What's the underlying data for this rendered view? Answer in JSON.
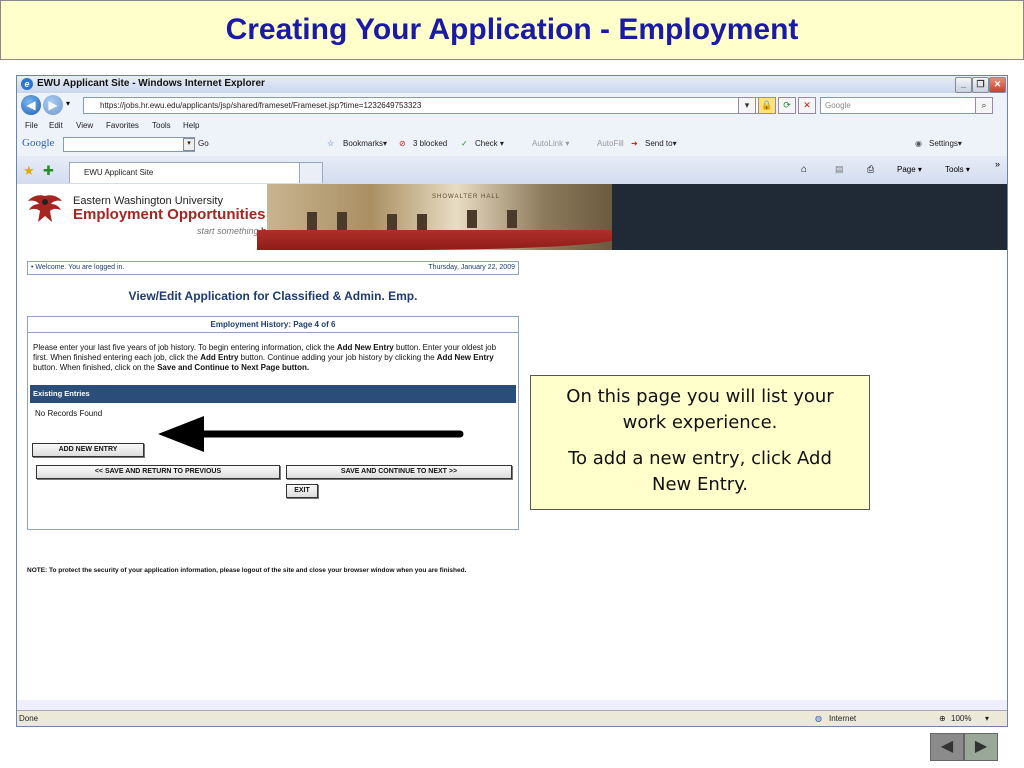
{
  "slide": {
    "title": "Creating Your Application - Employment",
    "callout_line1": "On this page you will list your work experience.",
    "callout_line2": "To add a new entry, click Add New Entry.",
    "prev_label": "◀",
    "next_label": "▶"
  },
  "browser": {
    "window_title": "EWU Applicant Site - Windows Internet Explorer",
    "url": "https://jobs.hr.ewu.edu/applicants/jsp/shared/frameset/Frameset.jsp?time=1232649753323",
    "search_placeholder": "Google",
    "menu": [
      "File",
      "Edit",
      "View",
      "Favorites",
      "Tools",
      "Help"
    ],
    "google_toolbar": {
      "logo": "Google",
      "go": "Go",
      "bookmarks": "Bookmarks▾",
      "blocked": "3 blocked",
      "check": "Check ▾",
      "autolink": "AutoLink ▾",
      "autofill": "AutoFill",
      "send_to": "Send to▾",
      "settings": "Settings▾"
    },
    "tab_label": "EWU Applicant Site",
    "command_bar": {
      "page": "Page ▾",
      "tools": "Tools ▾"
    },
    "status": {
      "left": "Done",
      "zone": "Internet",
      "zoom": "100%"
    }
  },
  "page": {
    "university": "Eastern Washington University",
    "employment": "Employment Opportunities",
    "tagline_a": "start something",
    "tagline_b": "big",
    "building_sign": "SHOWALTER HALL",
    "welcome": "• Welcome. You are logged in.",
    "date": "Thursday, January 22, 2009",
    "heading": "View/Edit Application for Classified & Admin. Emp.",
    "panel_header": "Employment History: Page 4 of 6",
    "instr": {
      "t1": "Please enter your last five years of job history. To begin entering information, click the ",
      "b1": "Add New Entry",
      "t2": " button. Enter your oldest job first. When finished entering each job, click the ",
      "b2": "Add Entry",
      "t3": " button. Continue adding your job history by clicking the ",
      "b3": "Add New Entry",
      "t4": " button. When finished, click on the ",
      "b4": "Save and Continue to Next Page button."
    },
    "existing_entries": "Existing Entries",
    "no_records": "No Records Found",
    "add_new_entry": "ADD NEW ENTRY",
    "save_prev": "<< SAVE AND RETURN TO PREVIOUS",
    "save_next": "SAVE AND CONTINUE TO NEXT >>",
    "exit": "EXIT",
    "note": "NOTE:   To protect the security of your application information, please logout of the site and close your browser window when you are finished."
  }
}
